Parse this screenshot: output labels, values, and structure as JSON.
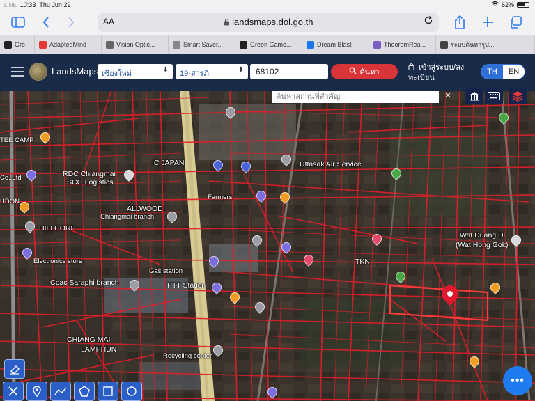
{
  "status_bar": {
    "carrier": "LINE",
    "time": "10:33",
    "date": "Thu Jun 29",
    "battery": "62%"
  },
  "safari": {
    "reader_label": "AA",
    "url": "landsmaps.dol.go.th"
  },
  "tabs": [
    {
      "label": "Gre",
      "color": "#222222"
    },
    {
      "label": "AdaptedMind",
      "color": "#e53935"
    },
    {
      "label": "Vision Optic...",
      "color": "#666666"
    },
    {
      "label": "Smart Saver...",
      "color": "#888888"
    },
    {
      "label": "Green Game...",
      "color": "#222222"
    },
    {
      "label": "Dream Blast",
      "color": "#1877f2"
    },
    {
      "label": "TheoremRea...",
      "color": "#7a5cc5"
    },
    {
      "label": "ระบบค้นหารูป...",
      "color": "#444444"
    }
  ],
  "navbar": {
    "app_name": "LandsMaps",
    "province": "เชียงใหม่",
    "district": "19-สารภี",
    "parcel_number": "68102",
    "search_button": "ค้นหา",
    "login_label": "เข้าสู่ระบบ/ลงทะเบียน",
    "lang_th": "TH",
    "lang_en": "EN"
  },
  "map": {
    "place_search_placeholder": "ค้นหาสถานที่สำคัญ",
    "close_symbol": "✕",
    "labels": {
      "tee_camp": "TEE CAMP",
      "co_ltd": "Co.,Ltd",
      "udon": "UDON",
      "ic_japan": "IC JAPAN",
      "rdc": "RDC Chiangmai",
      "scg": "SCG Logistics",
      "farmers": "Farmers'",
      "uttasak": "Uttasak Air Service",
      "allwood": "ALLWOOD",
      "allwood_branch": "Chiangmai branch",
      "hillcorp": "HILLCORP",
      "wat_duang_di": "Wat Duang Di",
      "wat_hong_gok": "(Wat Hong Gok)",
      "electronics_store": "Electronics store",
      "gas_station": "Gas station",
      "tkn": "TKN",
      "cpac": "Cpac Saraphi branch",
      "ptt": "PTT Station",
      "chiang_mai": "CHIANG MAI",
      "lamphun": "LAMPHUN",
      "recycling_center": "Recycling center"
    }
  },
  "tools": {
    "fab_label": "•••"
  }
}
